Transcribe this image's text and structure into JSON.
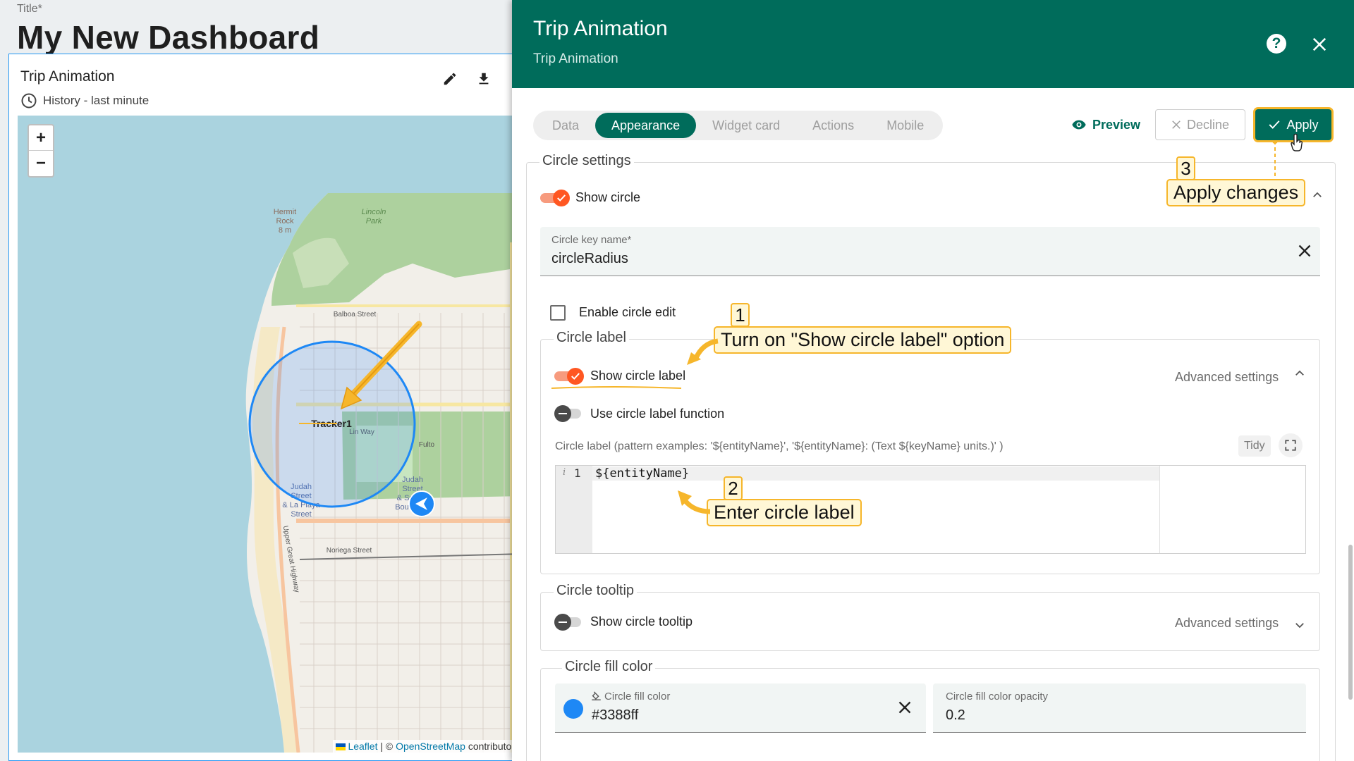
{
  "dashboard": {
    "title_label": "Title*",
    "title": "My New Dashboard"
  },
  "widget": {
    "title": "Trip Animation",
    "subtitle": "History - last minute",
    "map": {
      "zoom_in": "+",
      "zoom_out": "−",
      "marker_label": "Tracker1",
      "places": [
        "Hermit Rock 8 m",
        "Lincoln Park",
        "Balboa Street",
        "Fulto",
        "Judah Street & La Playa Street",
        "Judah Street & Sunset Boulevard",
        "Noriega Street",
        "Upper Great Highway",
        "Lin Way"
      ],
      "attribution": {
        "leaflet": "Leaflet",
        "separator": " | © ",
        "osm": "OpenStreetMap",
        "contributors": " contributors"
      }
    }
  },
  "panel": {
    "title": "Trip Animation",
    "subtitle": "Trip Animation",
    "tabs": [
      {
        "label": "Data",
        "active": false
      },
      {
        "label": "Appearance",
        "active": true
      },
      {
        "label": "Widget card",
        "active": false
      },
      {
        "label": "Actions",
        "active": false
      },
      {
        "label": "Mobile",
        "active": false
      }
    ],
    "preview_label": "Preview",
    "decline_label": "Decline",
    "apply_label": "Apply"
  },
  "circle_settings": {
    "legend": "Circle settings",
    "show_circle_label": "Show circle",
    "show_circle_on": true,
    "key_name_label": "Circle key name*",
    "key_name_value": "circleRadius",
    "enable_edit_label": "Enable circle edit",
    "enable_edit_checked": false
  },
  "circle_label": {
    "legend": "Circle label",
    "show_label": "Show circle label",
    "show_label_on": true,
    "advanced": "Advanced settings",
    "use_function_label": "Use circle label function",
    "use_function_on": false,
    "pattern_help": "Circle label (pattern examples: '${entityName}', '${entityName}: (Text ${keyName} units.)' )",
    "tidy_label": "Tidy",
    "editor_line_info": "i",
    "editor_line_number": "1",
    "editor_text": "${entityName}"
  },
  "circle_tooltip": {
    "legend": "Circle tooltip",
    "show_tooltip_label": "Show circle tooltip",
    "show_tooltip_on": false,
    "advanced": "Advanced settings"
  },
  "circle_fill": {
    "legend": "Circle fill color",
    "color_label": "Circle fill color",
    "color_value": "#3388ff",
    "opacity_label": "Circle fill color opacity",
    "opacity_value": "0.2"
  },
  "annotations": {
    "step1_num": "1",
    "step1_text": "Turn on \"Show circle label\" option",
    "step2_num": "2",
    "step2_text": "Enter circle label",
    "step3_num": "3",
    "step3_text": "Apply changes"
  },
  "colors": {
    "header_bg": "#006c5b",
    "toggle_on": "#ff5722",
    "annotation_border": "#f6b62b",
    "circle_stroke": "#1e88f5"
  }
}
